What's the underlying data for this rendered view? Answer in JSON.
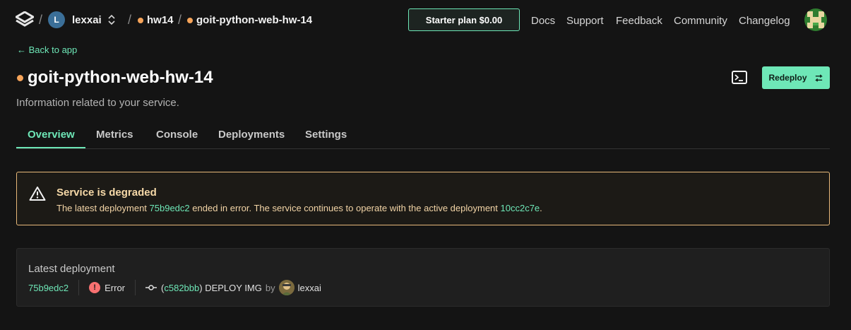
{
  "header": {
    "org_initial": "L",
    "org_name": "lexxai",
    "project": "hw14",
    "service": "goit-python-web-hw-14",
    "plan_label": "Starter plan $0.00",
    "links": [
      "Docs",
      "Support",
      "Feedback",
      "Community",
      "Changelog"
    ]
  },
  "page": {
    "back_label": "← Back to app",
    "title": "goit-python-web-hw-14",
    "subtitle": "Information related to your service.",
    "redeploy_label": "Redeploy"
  },
  "tabs": [
    {
      "label": "Overview",
      "active": true
    },
    {
      "label": "Metrics",
      "active": false
    },
    {
      "label": "Console",
      "active": false
    },
    {
      "label": "Deployments",
      "active": false
    },
    {
      "label": "Settings",
      "active": false
    }
  ],
  "alert": {
    "title": "Service is degraded",
    "text_before": "The latest deployment ",
    "failed_id": "75b9edc2",
    "text_middle": " ended in error. The service continues to operate with the active deployment ",
    "active_id": "10cc2c7e",
    "text_after": "."
  },
  "latest_deployment": {
    "label": "Latest deployment",
    "id": "75b9edc2",
    "status": "Error",
    "commit_hash": "c582bbb",
    "commit_message": "DEPLOY IMG",
    "by_label": "by",
    "author": "lexxai"
  },
  "colors": {
    "accent": "#6ee7b7",
    "warning": "#e8b97a",
    "error": "#f87171",
    "status_dot": "#f6a45a"
  },
  "icons": [
    "logo-icon",
    "chevron-updown-icon",
    "terminal-icon",
    "redeploy-arrows-icon",
    "warning-triangle-icon",
    "error-icon",
    "commit-icon"
  ]
}
